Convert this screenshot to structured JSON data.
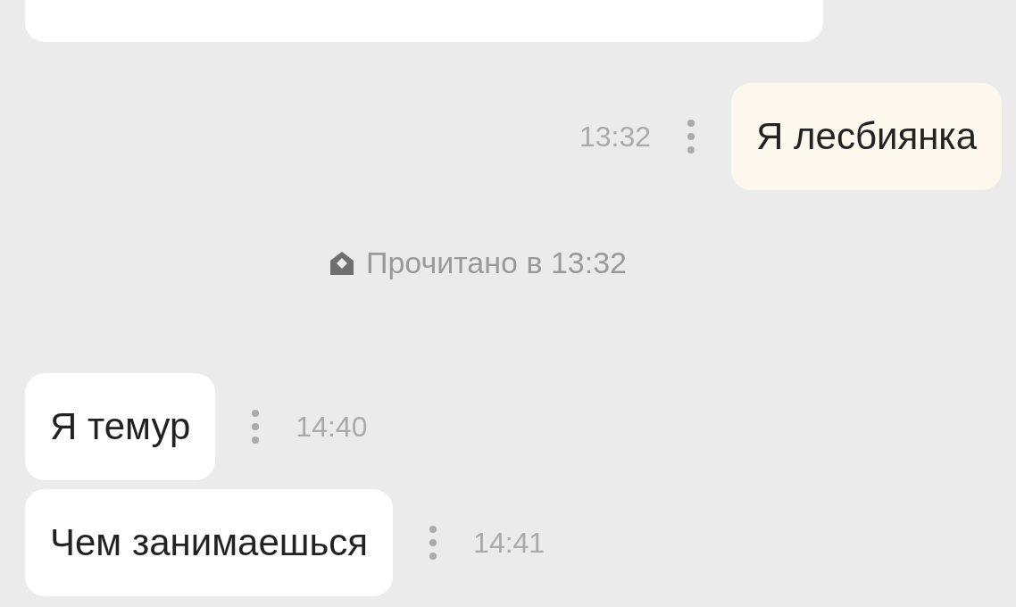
{
  "messages": [
    {
      "kind": "incoming",
      "cut": true
    },
    {
      "kind": "outgoing",
      "text": "Я лесбиянка",
      "time": "13:32"
    },
    {
      "kind": "receipt",
      "text": "Прочитано в 13:32"
    },
    {
      "kind": "incoming",
      "text": "Я темур",
      "time": "14:40"
    },
    {
      "kind": "incoming",
      "text": "Чем занимаешься",
      "time": "14:41"
    }
  ]
}
